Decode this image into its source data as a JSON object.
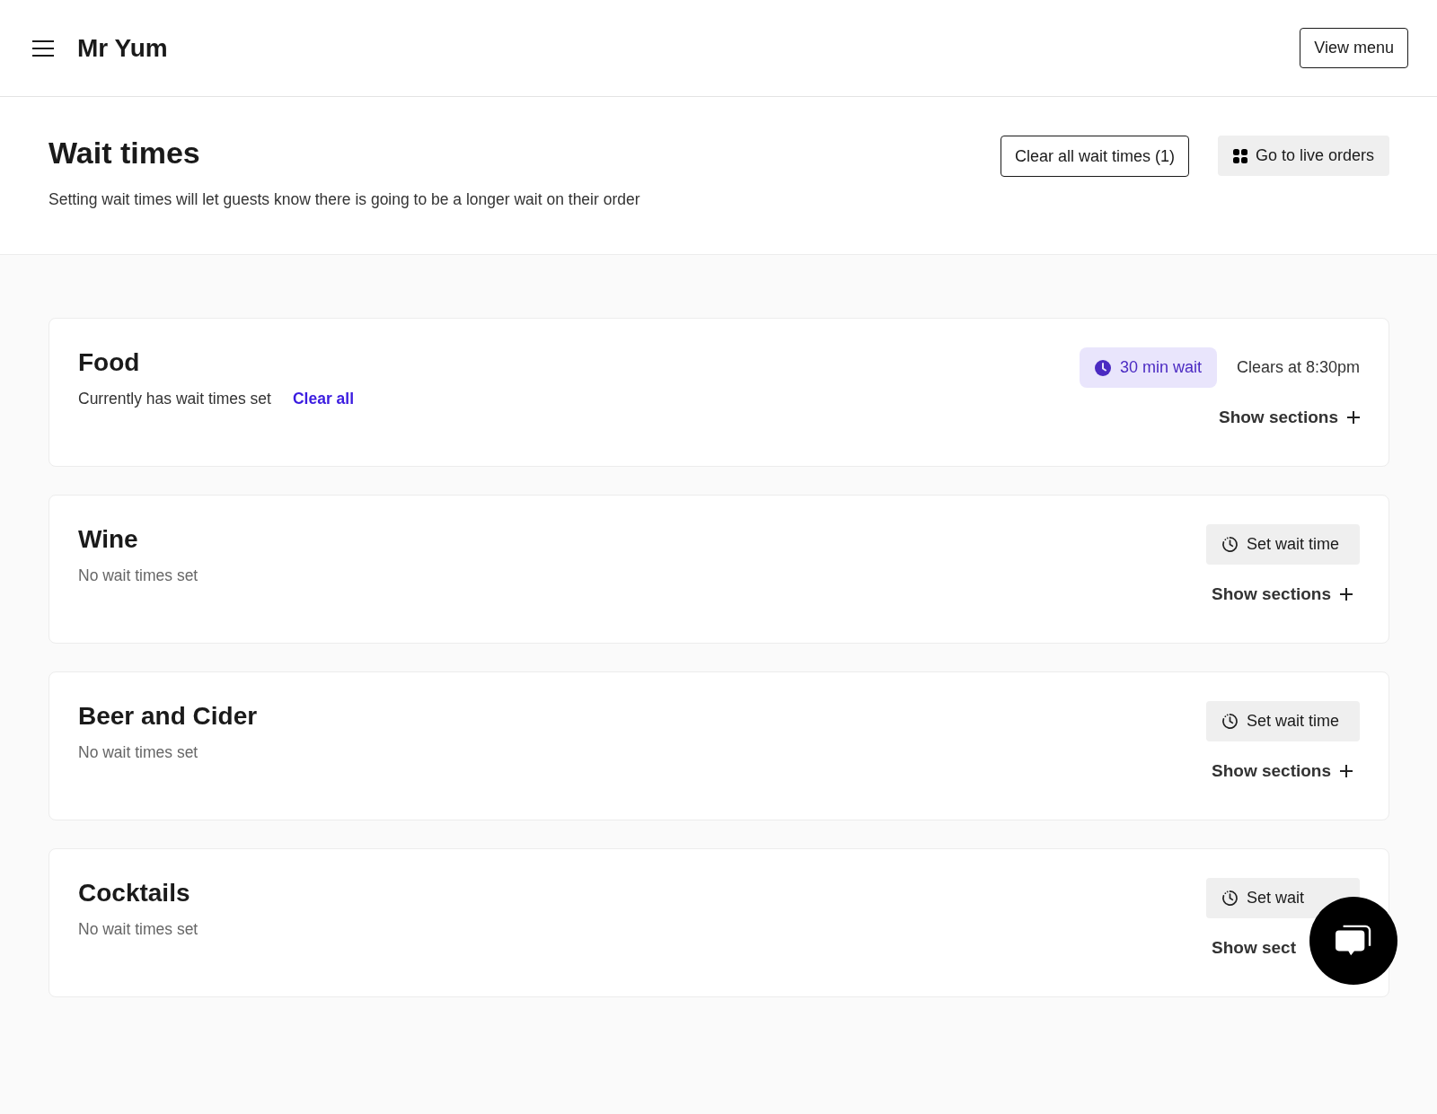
{
  "header": {
    "brand": "Mr Yum",
    "view_menu": "View menu"
  },
  "page": {
    "title": "Wait times",
    "description": "Setting wait times will let guests know there is going to be a longer wait on their order",
    "clear_all_button": "Clear all wait times (1)",
    "live_orders_button": "Go to live orders"
  },
  "cards": [
    {
      "kind": "active",
      "title": "Food",
      "status": "Currently has wait times set",
      "clear_link": "Clear all",
      "wait_badge": "30 min wait",
      "clears_at": "Clears at 8:30pm",
      "show_sections": "Show sections",
      "expand_icon": true
    },
    {
      "kind": "empty",
      "title": "Wine",
      "status": "No wait times set",
      "set_button": "Set wait time",
      "show_sections": "Show sections",
      "expand_icon": true
    },
    {
      "kind": "empty",
      "title": "Beer and Cider",
      "status": "No wait times set",
      "set_button": "Set wait time",
      "show_sections": "Show sections",
      "expand_icon": true
    },
    {
      "kind": "empty",
      "title": "Cocktails",
      "status": "No wait times set",
      "set_button": "Set wait",
      "show_sections": "Show sect",
      "expand_icon": false
    }
  ]
}
